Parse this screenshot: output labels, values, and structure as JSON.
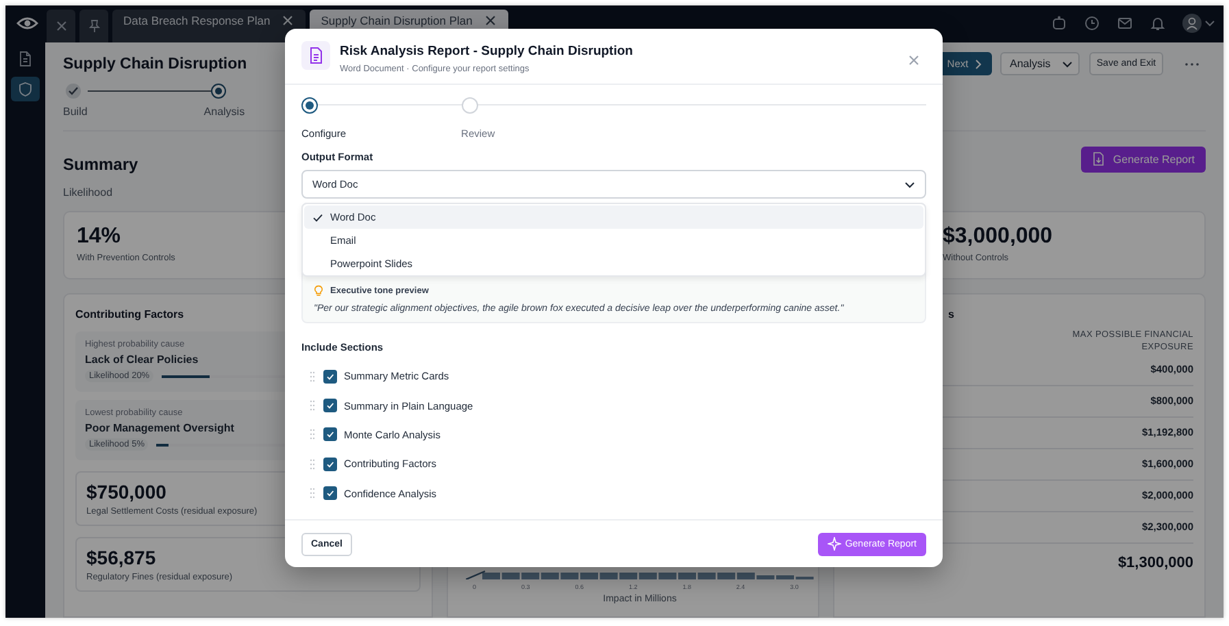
{
  "sidebar": {
    "items": [
      {
        "kind": "document",
        "selected": false
      },
      {
        "kind": "shield",
        "selected": true
      }
    ]
  },
  "tabs": [
    {
      "label": "Data Breach Response Plan",
      "selected": false
    },
    {
      "label": "Supply Chain Disruption Plan",
      "selected": true
    }
  ],
  "page": {
    "title": "Supply Chain Disruption",
    "steps": [
      {
        "label": "Build",
        "completed": true,
        "selected": false
      },
      {
        "label": "Analysis",
        "completed": false,
        "selected": true
      }
    ],
    "next_button": "Next",
    "view_select": "Analysis",
    "save_button": "Save and Exit"
  },
  "summary": {
    "heading": "Summary",
    "generate_button": "Generate Report",
    "likelihood_label": "Likelihood",
    "metric_cards": [
      {
        "value": "14%",
        "caption": "With Prevention Controls"
      },
      {
        "value": "$3,000,000",
        "caption": "Without Controls"
      }
    ]
  },
  "contributing_factors": {
    "title": "Contributing Factors",
    "causes": [
      {
        "caption": "Highest probability cause",
        "name": "Lack of Clear Policies",
        "likelihood": "Likelihood 20%",
        "level": 0.2
      },
      {
        "caption": "Lowest probability cause",
        "name": "Poor Management Oversight",
        "likelihood": "Likelihood 5%",
        "level": 0.05
      }
    ],
    "cost_cards": [
      {
        "value": "$750,000",
        "caption": "Legal Settlement Costs (residual exposure)"
      },
      {
        "value": "$56,875",
        "caption": "Regulatory Fines (residual exposure)"
      }
    ]
  },
  "impact_chart": {
    "tick_labels": [
      "0",
      "0.3",
      "0.6",
      "1.2",
      "1.8",
      "2.4",
      "3.0"
    ],
    "xlabel": "Impact in Millions"
  },
  "exposure_table": {
    "title_visible": "s",
    "column": "MAX POSSIBLE FINANCIAL EXPOSURE",
    "values": [
      "$400,000",
      "$800,000",
      "$1,192,800",
      "$1,600,000",
      "$2,000,000",
      "$2,300,000"
    ],
    "total": "$1,300,000"
  },
  "modal": {
    "title": "Risk Analysis Report - Supply Chain Disruption",
    "subtitle": "Word Document · Configure your report settings",
    "steps": [
      {
        "label": "Configure",
        "selected": true
      },
      {
        "label": "Review",
        "selected": false
      }
    ],
    "output_format": {
      "label": "Output Format",
      "value": "Word Doc",
      "options": [
        {
          "label": "Word Doc",
          "selected": true
        },
        {
          "label": "Email",
          "selected": false
        },
        {
          "label": "Powerpoint Slides",
          "selected": false
        }
      ]
    },
    "preview": {
      "label": "Executive tone preview",
      "quote": "\"Per our strategic alignment objectives, the agile brown fox executed a decisive leap over the underperforming canine asset.\""
    },
    "sections_label": "Include Sections",
    "sections": [
      {
        "label": "Summary Metric Cards",
        "checked": true
      },
      {
        "label": "Summary in Plain Language",
        "checked": true
      },
      {
        "label": "Monte Carlo Analysis",
        "checked": true
      },
      {
        "label": "Contributing Factors",
        "checked": true
      },
      {
        "label": "Confidence Analysis",
        "checked": true
      }
    ],
    "cancel_button": "Cancel",
    "generate_button": "Generate Report"
  }
}
